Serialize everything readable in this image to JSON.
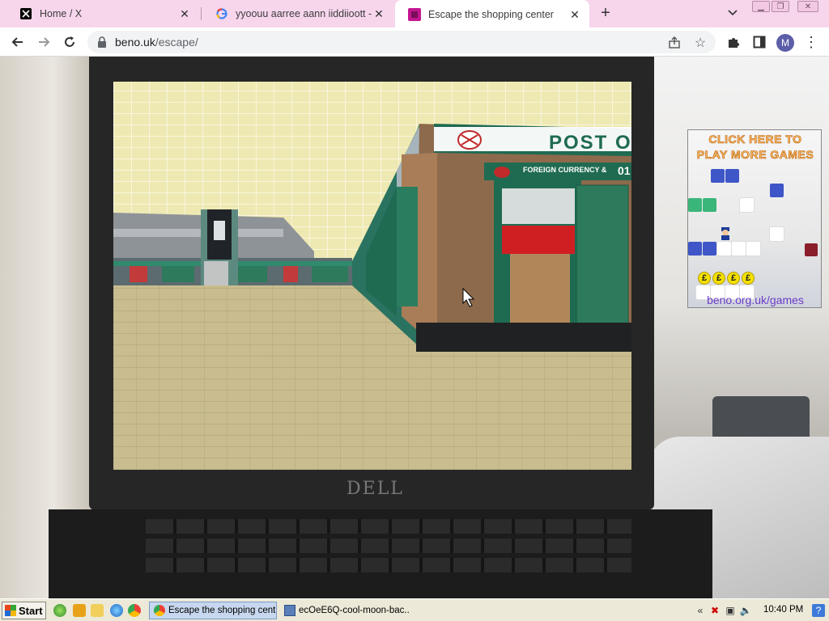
{
  "browser": {
    "tabs": [
      {
        "title": "Home / X",
        "favicon": "x-logo-icon",
        "active": false
      },
      {
        "title": "yyoouu aarree aann iiddiioott - G",
        "favicon": "google-icon",
        "active": false
      },
      {
        "title": "Escape the shopping center",
        "favicon": "game-favicon-icon",
        "active": true
      }
    ],
    "address": {
      "host": "beno.uk",
      "path": "/escape/"
    },
    "profile_initial": "M"
  },
  "game": {
    "shop_sign": "POST O",
    "shop_subsign": "FOREIGN CURRENCY &",
    "shop_subsign_number": "01"
  },
  "ad": {
    "headline_line1": "CLICK HERE TO",
    "headline_line2": "PLAY MORE GAMES",
    "coin_symbol": "£",
    "url": "beno.org.uk/games"
  },
  "webcam": {
    "laptop_brand": "DELL"
  },
  "taskbar": {
    "start_label": "Start",
    "tasks": [
      {
        "label": "Escape the shopping cent...",
        "active": true
      },
      {
        "label": "ecOeE6Q-cool-moon-bac...",
        "active": false
      }
    ],
    "tray_expand": "«",
    "clock": "10:40 PM"
  },
  "colors": {
    "tab_strip": "#f7d6ec",
    "ad_title": "#ffbe6a",
    "ad_url": "#6a3cc8",
    "shop_green": "#1f6b52"
  }
}
